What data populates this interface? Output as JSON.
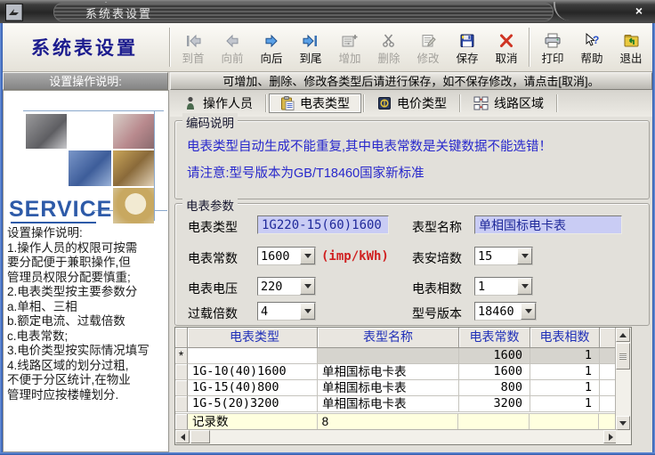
{
  "window": {
    "title": "系统表设置",
    "close_glyph": "×"
  },
  "toolbar": {
    "app_title": "系统表设置",
    "buttons": [
      {
        "id": "first",
        "label": "到首",
        "enabled": false
      },
      {
        "id": "prev",
        "label": "向前",
        "enabled": false
      },
      {
        "id": "next",
        "label": "向后",
        "enabled": true
      },
      {
        "id": "last",
        "label": "到尾",
        "enabled": true
      },
      {
        "id": "add",
        "label": "增加",
        "enabled": false
      },
      {
        "id": "delete",
        "label": "删除",
        "enabled": false
      },
      {
        "id": "edit",
        "label": "修改",
        "enabled": false
      },
      {
        "id": "save",
        "label": "保存",
        "enabled": true
      },
      {
        "id": "cancel",
        "label": "取消",
        "enabled": true
      },
      {
        "id": "print",
        "label": "打印",
        "enabled": true
      },
      {
        "id": "help",
        "label": "帮助",
        "enabled": true
      },
      {
        "id": "exit",
        "label": "退出",
        "enabled": true
      }
    ]
  },
  "info_bars": {
    "left": "设置操作说明:",
    "right": "可增加、删除、修改各类型后请进行保存，如不保存修改，请点击[取消]。"
  },
  "sidebar": {
    "service_label": "SERVICE",
    "instructions": "设置操作说明:\n1.操作人员的权限可按需\n要分配便于兼职操作,但\n管理员权限分配要慎重;\n2.电表类型按主要参数分\na.单相、三相\nb.额定电流、过载倍数\nc.电表常数;\n3.电价类型按实际情况填写\n4.线路区域的划分过粗,\n不便于分区统计,在物业\n管理时应按楼幢划分."
  },
  "tabs": [
    {
      "label": "操作人员"
    },
    {
      "label": "电表类型"
    },
    {
      "label": "电价类型"
    },
    {
      "label": "线路区域"
    }
  ],
  "encoding_box": {
    "title": "编码说明",
    "line1": "电表类型自动生成不能重复,其中电表常数是关键数据不能选错！",
    "line2": "请注意:型号版本为GB/T18460国家新标准"
  },
  "params_box": {
    "title": "电表参数",
    "meter_type": {
      "label": "电表类型",
      "value": "1G220-15(60)1600"
    },
    "model_name": {
      "label": "表型名称",
      "value": "单相国标电卡表"
    },
    "constant": {
      "label": "电表常数",
      "value": "1600",
      "unit": "(imp/kWh)"
    },
    "ampere": {
      "label": "表安培数",
      "value": "15"
    },
    "voltage": {
      "label": "电表电压",
      "value": "220"
    },
    "phase": {
      "label": "电表相数",
      "value": "1"
    },
    "overload": {
      "label": "过载倍数",
      "value": "4"
    },
    "version": {
      "label": "型号版本",
      "value": "18460"
    }
  },
  "grid": {
    "headers": [
      "电表类型",
      "表型名称",
      "电表常数",
      "电表相数"
    ],
    "rows": [
      {
        "marker": "*",
        "type": "",
        "name": "",
        "constant": "1600",
        "phase": "1"
      },
      {
        "marker": "",
        "type": "1G-10(40)1600",
        "name": "单相国标电卡表",
        "constant": "1600",
        "phase": "1"
      },
      {
        "marker": "",
        "type": "1G-15(40)800",
        "name": "单相国标电卡表",
        "constant": "800",
        "phase": "1"
      },
      {
        "marker": "",
        "type": "1G-5(20)3200",
        "name": "单相国标电卡表",
        "constant": "3200",
        "phase": "1"
      }
    ],
    "footer": {
      "label": "记录数",
      "value": "8"
    }
  }
}
